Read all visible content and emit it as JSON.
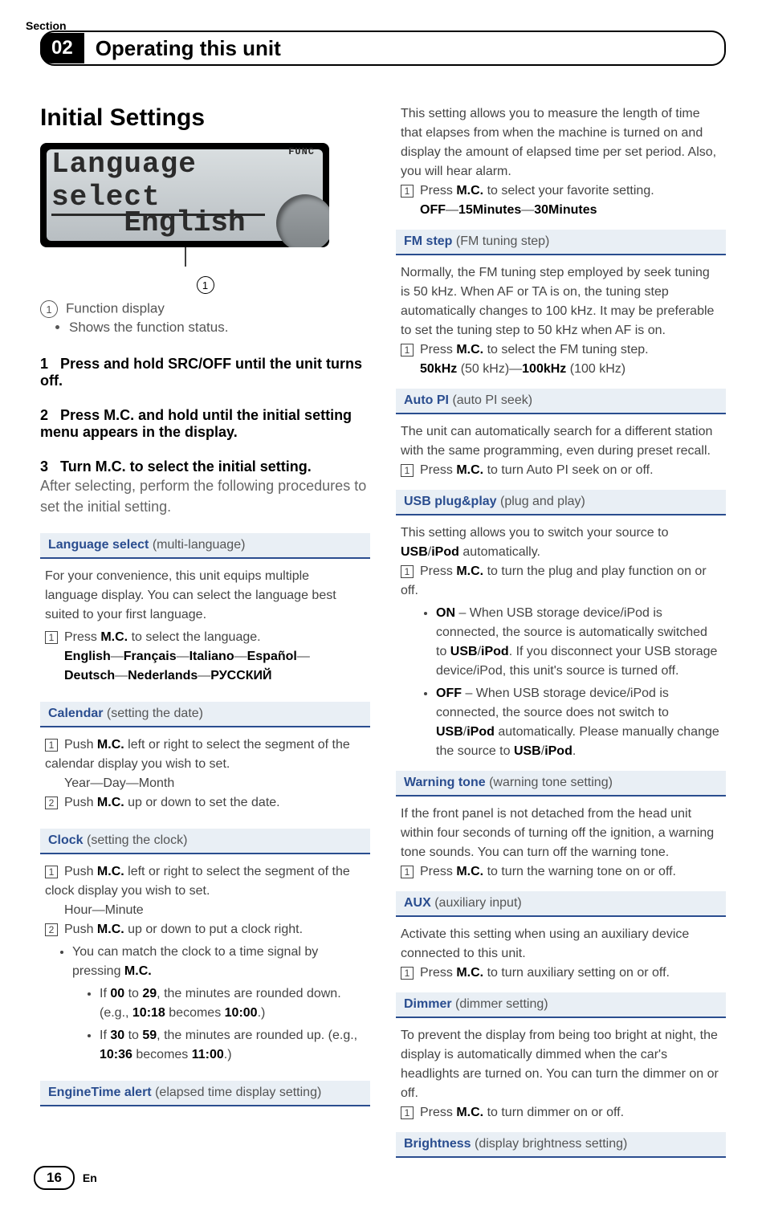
{
  "header": {
    "section_label": "Section",
    "section_number": "02",
    "section_title": "Operating this unit"
  },
  "main_heading": "Initial Settings",
  "lcd": {
    "row1": "Language select",
    "row2": "English",
    "func_label": "FUNC",
    "callout_number": "1"
  },
  "function_display": {
    "num": "1",
    "label": "Function display",
    "bullet": "Shows the function status."
  },
  "steps": {
    "s1_num": "1",
    "s1_text": "Press and hold SRC/OFF until the unit turns off.",
    "s2_num": "2",
    "s2_text": "Press M.C. and hold until the initial setting menu appears in the display.",
    "s3_num": "3",
    "s3_text": "Turn M.C. to select the initial setting.",
    "s3_desc": "After selecting, perform the following procedures to set the initial setting."
  },
  "left_blocks": {
    "lang": {
      "title_bold": "Language select",
      "title_sub": " (multi-language)",
      "body1": "For your convenience, this unit equips multiple language display. You can select the language best suited to your first language.",
      "item1_pre": "Press ",
      "item1_mc": "M.C.",
      "item1_post": " to select the language.",
      "options_a": "English",
      "options_b": "Français",
      "options_c": "Italiano",
      "options_d": "Español",
      "options_e": "Deutsch",
      "options_f": "Nederlands",
      "options_g": "РУССКИЙ"
    },
    "calendar": {
      "title_bold": "Calendar",
      "title_sub": " (setting the date)",
      "item1_pre": "Push ",
      "item1_mc": "M.C.",
      "item1_post": " left or right to select the segment of the calendar display you wish to set.",
      "ydm": "Year—Day—Month",
      "item2_pre": "Push ",
      "item2_mc": "M.C.",
      "item2_post": " up or down to set the date."
    },
    "clock": {
      "title_bold": "Clock",
      "title_sub": " (setting the clock)",
      "item1_pre": "Push ",
      "item1_mc": "M.C.",
      "item1_post": " left or right to select the segment of the clock display you wish to set.",
      "hm": "Hour—Minute",
      "item2_pre": "Push ",
      "item2_mc": "M.C.",
      "item2_post": " up or down to put a clock right.",
      "match_pre": "You can match the clock to a time signal by pressing ",
      "match_mc": "M.C.",
      "b1_if": "If ",
      "b1_range_a": "00",
      "b1_to": " to ",
      "b1_range_b": "29",
      "b1_round": ", the minutes are rounded down. (e.g., ",
      "b1_ex_a": "10:18",
      "b1_bec": " becomes ",
      "b1_ex_b": "10:00",
      "b1_end": ".)",
      "b2_if": "If ",
      "b2_range_a": "30",
      "b2_to": " to ",
      "b2_range_b": "59",
      "b2_round": ", the minutes are rounded up. (e.g., ",
      "b2_ex_a": "10:36",
      "b2_bec": " becomes ",
      "b2_ex_b": "11:00",
      "b2_end": ".)"
    },
    "enginetime": {
      "title_bold": "EngineTime alert",
      "title_sub": " (elapsed time display setting)"
    }
  },
  "right_blocks": {
    "enginetime_body": {
      "para": "This setting allows you to measure the length of time that elapses from when the machine is turned on and display the amount of elapsed time per set period. Also, you will hear alarm.",
      "press_pre": "Press ",
      "press_mc": "M.C.",
      "press_post": " to select your favorite setting.",
      "opt_a": "OFF",
      "opt_b": "15Minutes",
      "opt_c": "30Minutes"
    },
    "fmstep": {
      "title_bold": "FM step",
      "title_sub": " (FM tuning step)",
      "para": "Normally, the FM tuning step employed by seek tuning is 50 kHz. When AF or TA is on, the tuning step automatically changes to 100 kHz. It may be preferable to set the tuning step to 50 kHz when AF is on.",
      "press_pre": "Press ",
      "press_mc": "M.C.",
      "press_post": " to select the FM tuning step.",
      "opt_a": "50kHz",
      "opt_a_sub": " (50 kHz)—",
      "opt_b": "100kHz",
      "opt_b_sub": " (100 kHz)"
    },
    "autopi": {
      "title_bold": "Auto PI",
      "title_sub": " (auto PI seek)",
      "para": "The unit can automatically search for a different station with the same programming, even during preset recall.",
      "press_pre": "Press ",
      "press_mc": "M.C.",
      "press_post": " to turn Auto PI seek on or off."
    },
    "usbpp": {
      "title_bold": "USB plug&play",
      "title_sub": " (plug and play)",
      "para_pre": "This setting allows you to switch your source to ",
      "usb": "USB",
      "slash": "/",
      "ipod": "iPod",
      "para_post": " automatically.",
      "press_pre": "Press ",
      "press_mc": "M.C.",
      "press_post": " to turn the plug and play function on or off.",
      "on_label": "ON",
      "on_pre": " – When USB storage device/iPod is connected, the source is automatically switched to ",
      "on_post": ". If you disconnect your USB storage device/iPod, this unit's source is turned off.",
      "off_label": "OFF",
      "off_pre": " – When USB storage device/iPod is connected, the source does not switch to ",
      "off_post": " automatically. Please manually change the source to ",
      "off_end": "."
    },
    "warntone": {
      "title_bold": "Warning tone",
      "title_sub": " (warning tone setting)",
      "para": "If the front panel is not detached from the head unit within four seconds of turning off the ignition, a warning tone sounds. You can turn off the warning tone.",
      "press_pre": "Press ",
      "press_mc": "M.C.",
      "press_post": " to turn the warning tone on or off."
    },
    "aux": {
      "title_bold": "AUX",
      "title_sub": " (auxiliary input)",
      "para": "Activate this setting when using an auxiliary device connected to this unit.",
      "press_pre": "Press ",
      "press_mc": "M.C.",
      "press_post": " to turn auxiliary setting on or off."
    },
    "dimmer": {
      "title_bold": "Dimmer",
      "title_sub": " (dimmer setting)",
      "para": "To prevent the display from being too bright at night, the display is automatically dimmed when the car's headlights are turned on. You can turn the dimmer on or off.",
      "press_pre": "Press ",
      "press_mc": "M.C.",
      "press_post": " to turn dimmer on or off."
    },
    "brightness": {
      "title_bold": "Brightness",
      "title_sub": " (display brightness setting)"
    }
  },
  "footer": {
    "page_number": "16",
    "lang": "En"
  },
  "glue": {
    "dash": "—",
    "period": "."
  }
}
